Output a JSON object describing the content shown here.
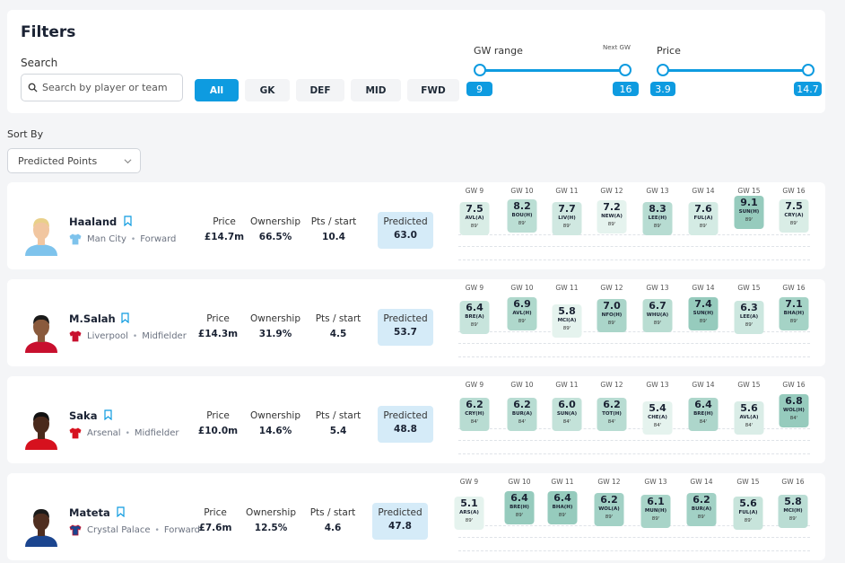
{
  "filters": {
    "title": "Filters",
    "search_label": "Search",
    "search_placeholder": "Search by player or team",
    "positions": [
      "All",
      "GK",
      "DEF",
      "MID",
      "FWD"
    ],
    "active_position": "All",
    "gw_range": {
      "label": "GW range",
      "next_gw_label": "Next GW",
      "min": "9",
      "max": "16"
    },
    "price": {
      "label": "Price",
      "min": "3.9",
      "max": "14.7"
    }
  },
  "sort": {
    "label": "Sort By",
    "value": "Predicted Points"
  },
  "stat_labels": {
    "price": "Price",
    "ownership": "Ownership",
    "pts": "Pts / start",
    "predicted": "Predicted"
  },
  "gw_labels": [
    "GW 9",
    "GW 10",
    "GW 11",
    "GW 12",
    "GW 13",
    "GW 14",
    "GW 15",
    "GW 16"
  ],
  "players": [
    {
      "name": "Haaland",
      "team": "Man City",
      "position": "Forward",
      "price": "£14.7m",
      "ownership": "66.5%",
      "pts": "10.4",
      "predicted": "63.0",
      "kit": {
        "body": "#7ec3ec",
        "sleeve": "#7ec3ec"
      },
      "avatar": {
        "skin": "#f1c6a0",
        "hair": "#e9d08a",
        "shirt": "#7ec3ec"
      },
      "fixtures": [
        {
          "p": "7.5",
          "o": "AVL(A)",
          "m": "89'"
        },
        {
          "p": "8.2",
          "o": "BOU(H)",
          "m": "89'"
        },
        {
          "p": "7.7",
          "o": "LIV(H)",
          "m": "89'"
        },
        {
          "p": "7.2",
          "o": "NEW(A)",
          "m": "89'"
        },
        {
          "p": "8.3",
          "o": "LEE(H)",
          "m": "89'"
        },
        {
          "p": "7.6",
          "o": "FUL(A)",
          "m": "89'"
        },
        {
          "p": "9.1",
          "o": "SUN(H)",
          "m": "89'"
        },
        {
          "p": "7.5",
          "o": "CRY(A)",
          "m": "89'"
        }
      ]
    },
    {
      "name": "M.Salah",
      "team": "Liverpool",
      "position": "Midfielder",
      "price": "£14.3m",
      "ownership": "31.9%",
      "pts": "4.5",
      "predicted": "53.7",
      "kit": {
        "body": "#c8102e",
        "sleeve": "#c8102e"
      },
      "avatar": {
        "skin": "#8a5a3c",
        "hair": "#1a1a1a",
        "shirt": "#c8102e"
      },
      "fixtures": [
        {
          "p": "6.4",
          "o": "BRE(A)",
          "m": "89'"
        },
        {
          "p": "6.9",
          "o": "AVL(H)",
          "m": "89'"
        },
        {
          "p": "5.8",
          "o": "MCI(A)",
          "m": "89'"
        },
        {
          "p": "7.0",
          "o": "NFO(H)",
          "m": "89'"
        },
        {
          "p": "6.7",
          "o": "WHU(A)",
          "m": "89'"
        },
        {
          "p": "7.4",
          "o": "SUN(H)",
          "m": "89'"
        },
        {
          "p": "6.3",
          "o": "LEE(A)",
          "m": "89'"
        },
        {
          "p": "7.1",
          "o": "BHA(H)",
          "m": "89'"
        }
      ]
    },
    {
      "name": "Saka",
      "team": "Arsenal",
      "position": "Midfielder",
      "price": "£10.0m",
      "ownership": "14.6%",
      "pts": "5.4",
      "predicted": "48.8",
      "kit": {
        "body": "#d6111e",
        "sleeve": "#d6111e"
      },
      "avatar": {
        "skin": "#4a2a1c",
        "hair": "#111111",
        "shirt": "#d6111e"
      },
      "fixtures": [
        {
          "p": "6.2",
          "o": "CRY(H)",
          "m": "84'"
        },
        {
          "p": "6.2",
          "o": "BUR(A)",
          "m": "84'"
        },
        {
          "p": "6.0",
          "o": "SUN(A)",
          "m": "84'"
        },
        {
          "p": "6.2",
          "o": "TOT(H)",
          "m": "84'"
        },
        {
          "p": "5.4",
          "o": "CHE(A)",
          "m": "84'"
        },
        {
          "p": "6.4",
          "o": "BRE(H)",
          "m": "84'"
        },
        {
          "p": "5.6",
          "o": "AVL(A)",
          "m": "84'"
        },
        {
          "p": "6.8",
          "o": "WOL(H)",
          "m": "84'"
        }
      ]
    },
    {
      "name": "Mateta",
      "team": "Crystal Palace",
      "position": "Forward",
      "price": "£7.6m",
      "ownership": "12.5%",
      "pts": "4.6",
      "predicted": "47.8",
      "kit": {
        "body": "#1b458f",
        "sleeve": "#c4122e"
      },
      "avatar": {
        "skin": "#4f2e20",
        "hair": "#1a1a1a",
        "shirt": "#1b458f"
      },
      "fixtures": [
        {
          "p": "5.1",
          "o": "ARS(A)",
          "m": "89'"
        },
        {
          "p": "6.4",
          "o": "BRE(H)",
          "m": "89'"
        },
        {
          "p": "6.4",
          "o": "BHA(H)",
          "m": "89'"
        },
        {
          "p": "6.2",
          "o": "WOL(A)",
          "m": "89'"
        },
        {
          "p": "6.1",
          "o": "MUN(H)",
          "m": "89'"
        },
        {
          "p": "6.2",
          "o": "BUR(A)",
          "m": "89'"
        },
        {
          "p": "5.6",
          "o": "FUL(A)",
          "m": "89'"
        },
        {
          "p": "5.8",
          "o": "MCI(H)",
          "m": "89'"
        }
      ]
    }
  ]
}
